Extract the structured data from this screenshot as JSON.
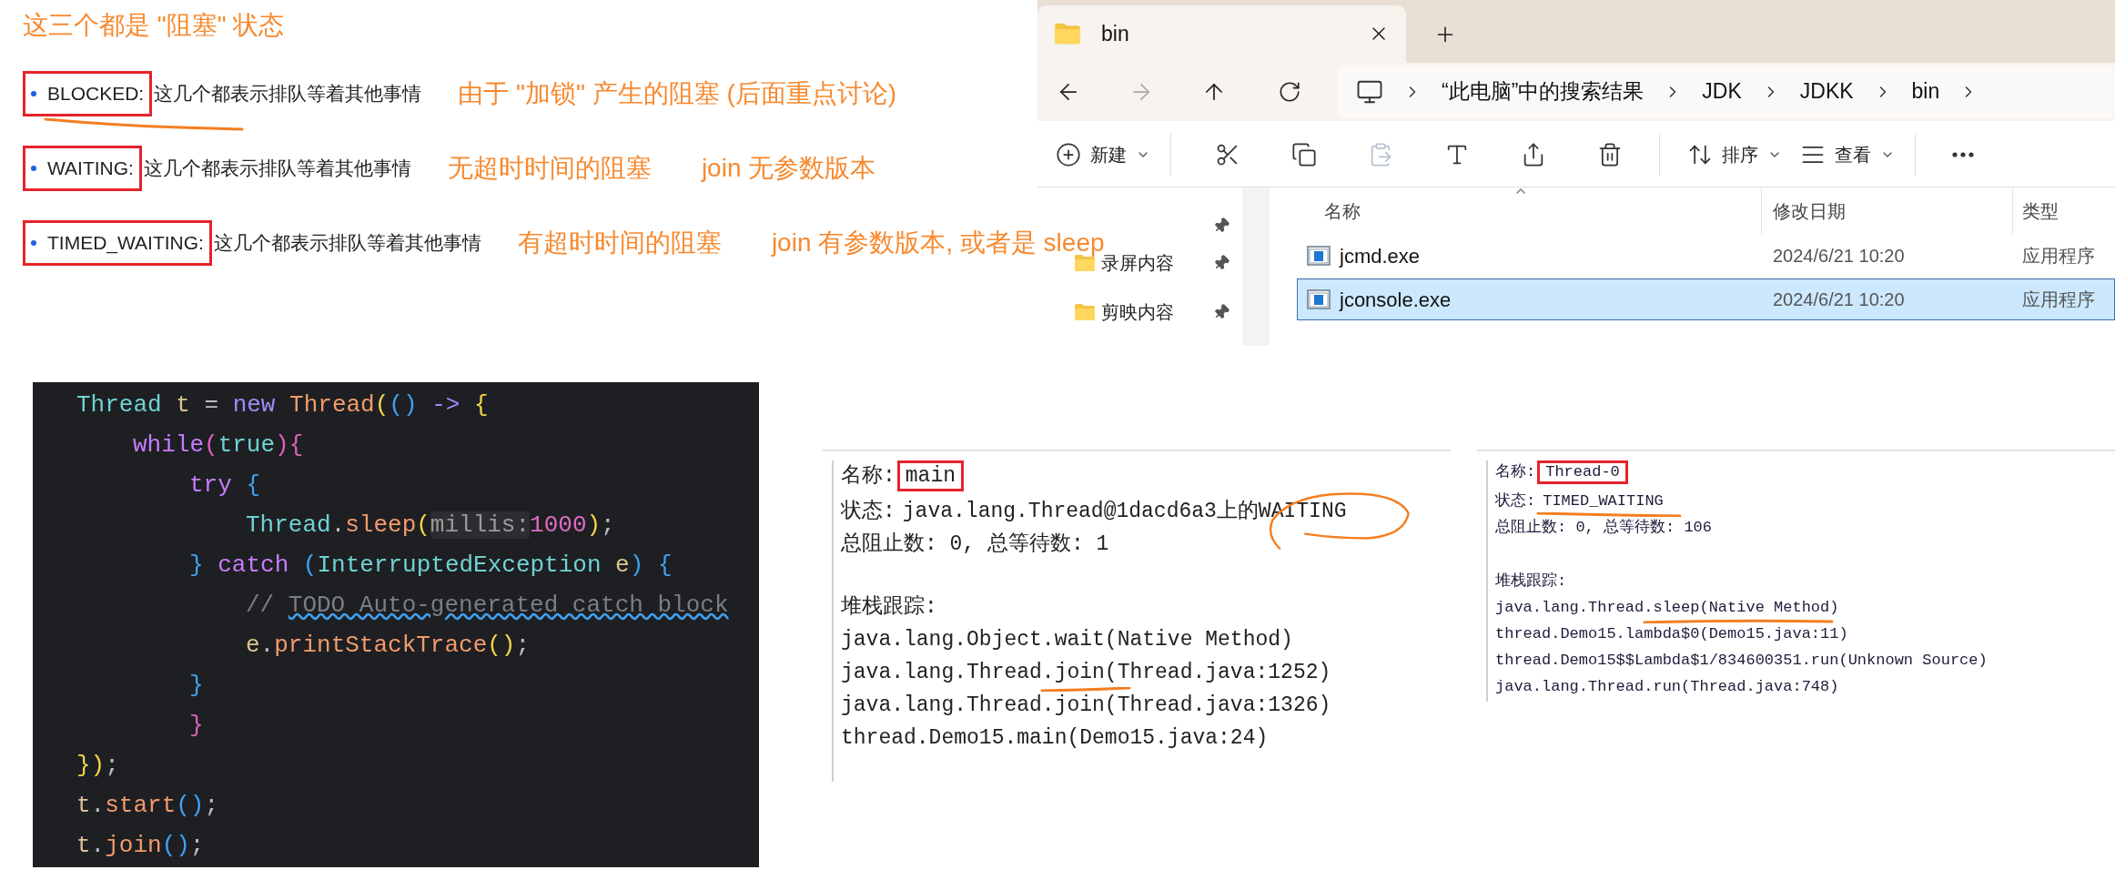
{
  "notes": {
    "title": "这三个都是 \"阻塞\" 状态",
    "states": [
      {
        "label": "BLOCKED:",
        "desc": "这几个都表示排队等着其他事情",
        "notes": [
          "由于 \"加锁\" 产生的阻塞 (后面重点讨论)"
        ]
      },
      {
        "label": "WAITING:",
        "desc": "这几个都表示排队等着其他事情",
        "notes": [
          "无超时时间的阻塞",
          "join 无参数版本"
        ]
      },
      {
        "label": "TIMED_WAITING:",
        "desc": "这几个都表示排队等着其他事情",
        "notes": [
          "有超时时间的阻塞",
          "join 有参数版本, 或者是 sleep"
        ]
      }
    ]
  },
  "explorer": {
    "tab": {
      "title": "bin"
    },
    "breadcrumbs": [
      "“此电脑”中的搜索结果",
      "JDK",
      "JDKK",
      "bin"
    ],
    "toolbar": [
      {
        "kind": "new",
        "label": "新建",
        "disabled": false
      },
      {
        "kind": "cut",
        "disabled": false
      },
      {
        "kind": "copy",
        "disabled": false
      },
      {
        "kind": "paste",
        "disabled": true
      },
      {
        "kind": "rename",
        "disabled": false
      },
      {
        "kind": "share",
        "disabled": false
      },
      {
        "kind": "delete",
        "disabled": false
      },
      {
        "kind": "sort",
        "label": "排序",
        "disabled": false
      },
      {
        "kind": "view",
        "label": "查看",
        "disabled": false
      },
      {
        "kind": "more",
        "disabled": false
      }
    ],
    "nav": [
      "录屏内容",
      "剪映内容"
    ],
    "columns": [
      "名称",
      "修改日期",
      "类型"
    ],
    "rows": [
      {
        "name": "jcmd.exe",
        "date": "2024/6/21 10:20",
        "type": "应用程序",
        "selected": false
      },
      {
        "name": "jconsole.exe",
        "date": "2024/6/21 10:20",
        "type": "应用程序",
        "selected": true
      }
    ]
  },
  "code": {
    "lines": [
      {
        "tokens": [
          {
            "text": "Thread",
            "kind": "type"
          },
          {
            "text": " t ",
            "kind": "var"
          },
          {
            "text": "= ",
            "kind": "plain"
          },
          {
            "text": "new ",
            "kind": "kw1"
          },
          {
            "text": "Thread",
            "kind": "call"
          },
          {
            "text": "(",
            "kind": "b1"
          },
          {
            "text": "()",
            "kind": "b2"
          },
          {
            "text": " -> ",
            "kind": "kw1"
          },
          {
            "text": "{",
            "kind": "b1"
          }
        ],
        "children": [
          {
            "tokens": [
              {
                "text": "while",
                "kind": "kw2"
              },
              {
                "text": "(",
                "kind": "b3"
              },
              {
                "text": "true",
                "kind": "type"
              },
              {
                "text": "){",
                "kind": "b3"
              }
            ],
            "children": [
              {
                "tokens": [
                  {
                    "text": "try ",
                    "kind": "kw2"
                  },
                  {
                    "text": "{",
                    "kind": "b2"
                  }
                ],
                "children": [
                  {
                    "tokens": [
                      {
                        "text": "Thread",
                        "kind": "type"
                      },
                      {
                        "text": ".",
                        "kind": "plain"
                      },
                      {
                        "text": "sleep",
                        "kind": "call"
                      },
                      {
                        "text": "(",
                        "kind": "b1"
                      },
                      {
                        "text": "millis:",
                        "kind": "hint"
                      },
                      {
                        "text": "1000",
                        "kind": "number"
                      },
                      {
                        "text": ")",
                        "kind": "b1"
                      },
                      {
                        "text": ";",
                        "kind": "plain"
                      }
                    ]
                  }
                ]
              },
              {
                "tokens": [
                  {
                    "text": "} ",
                    "kind": "b2"
                  },
                  {
                    "text": "catch ",
                    "kind": "kw2"
                  },
                  {
                    "text": "(",
                    "kind": "b2"
                  },
                  {
                    "text": "InterruptedException",
                    "kind": "type"
                  },
                  {
                    "text": " e",
                    "kind": "var"
                  },
                  {
                    "text": ") {",
                    "kind": "b2"
                  }
                ],
                "children": [
                  {
                    "tokens": [
                      {
                        "text": "// ",
                        "kind": "comment"
                      },
                      {
                        "text": "TODO Auto-generated catch block",
                        "kind": "todo"
                      }
                    ]
                  },
                  {
                    "tokens": [
                      {
                        "text": "e",
                        "kind": "var"
                      },
                      {
                        "text": ".",
                        "kind": "plain"
                      },
                      {
                        "text": "printStackTrace",
                        "kind": "call"
                      },
                      {
                        "text": "()",
                        "kind": "b1"
                      },
                      {
                        "text": ";",
                        "kind": "plain"
                      }
                    ]
                  }
                ]
              },
              {
                "tokens": [
                  {
                    "text": "}",
                    "kind": "b2"
                  }
                ]
              },
              {
                "tokens": [
                  {
                    "text": "}",
                    "kind": "b3"
                  }
                ]
              }
            ]
          }
        ]
      },
      {
        "tokens": [
          {
            "text": "})",
            "kind": "b1"
          },
          {
            "text": ";",
            "kind": "plain"
          }
        ]
      },
      {
        "tokens": [
          {
            "text": "t",
            "kind": "var"
          },
          {
            "text": ".",
            "kind": "plain"
          },
          {
            "text": "start",
            "kind": "call"
          },
          {
            "text": "()",
            "kind": "b2"
          },
          {
            "text": ";",
            "kind": "plain"
          }
        ]
      },
      {
        "tokens": [
          {
            "text": "t",
            "kind": "var"
          },
          {
            "text": ".",
            "kind": "plain"
          },
          {
            "text": "join",
            "kind": "call"
          },
          {
            "text": "()",
            "kind": "b2"
          },
          {
            "text": ";",
            "kind": "plain"
          }
        ]
      }
    ]
  },
  "threads": [
    {
      "name_label": "名称:",
      "name": "main",
      "state_label": "状态:",
      "state": "java.lang.Thread@1dacd6a3上的WAITING",
      "counts": "总阻止数: 0, 总等待数: 1",
      "stack_label": "堆栈跟踪:",
      "stack": [
        "java.lang.Object.wait(Native Method)",
        "java.lang.Thread.join(Thread.java:1252)",
        "java.lang.Thread.join(Thread.java:1326)",
        "thread.Demo15.main(Demo15.java:24)"
      ]
    },
    {
      "name_label": "名称:",
      "name": "Thread-0",
      "state_label": "状态:",
      "state": "TIMED_WAITING",
      "counts": "总阻止数: 0, 总等待数: 106",
      "stack_label": "堆栈跟踪:",
      "stack": [
        "java.lang.Thread.sleep(Native Method)",
        "thread.Demo15.lambda$0(Demo15.java:11)",
        "thread.Demo15$$Lambda$1/834600351.run(Unknown Source)",
        "java.lang.Thread.run(Thread.java:748)"
      ]
    }
  ]
}
